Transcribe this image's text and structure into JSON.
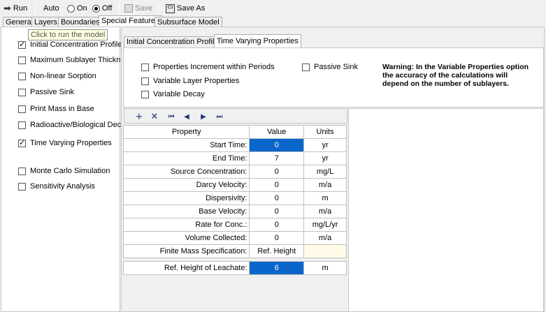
{
  "toolbar": {
    "run_label": "Run",
    "auto_label": "Auto",
    "on_label": "On",
    "off_label": "Off",
    "save_label": "Save",
    "save_as_label": "Save As"
  },
  "main_tabs": [
    "General",
    "Layers",
    "Boundaries",
    "Special Features",
    "Subsurface Model"
  ],
  "tooltip": "Click to run the model",
  "left_options": [
    {
      "label": "Initial Concentration Profile",
      "checked": true
    },
    {
      "label": "Maximum Sublayer Thickness",
      "checked": false
    },
    {
      "label": "Non-linear Sorption",
      "checked": false
    },
    {
      "label": "Passive Sink",
      "checked": false
    },
    {
      "label": "Print Mass in Base",
      "checked": false
    },
    {
      "label": "Radioactive/Biological Decay",
      "checked": false
    },
    {
      "label": "Time Varying Properties",
      "checked": true
    },
    {
      "label": "Monte Carlo Simulation",
      "checked": false
    },
    {
      "label": "Sensitivity Analysis",
      "checked": false
    }
  ],
  "sub_tabs": [
    "Initial Concentration Profile",
    "Time Varying Properties"
  ],
  "tvp_options": {
    "increment": "Properties Increment within Periods",
    "variable_layer": "Variable Layer Properties",
    "variable_decay": "Variable Decay",
    "passive_sink": "Passive Sink"
  },
  "warning": "Warning: In the Variable Properties option the accuracy of the calculations will depend on the number of sublayers.",
  "grid": {
    "headers": {
      "property": "Property",
      "value": "Value",
      "units": "Units"
    },
    "rows": [
      {
        "property": "Start Time:",
        "value": "0",
        "units": "yr"
      },
      {
        "property": "End Time:",
        "value": "7",
        "units": "yr"
      },
      {
        "property": "Source Concentration:",
        "value": "0",
        "units": "mg/L"
      },
      {
        "property": "Darcy Velocity:",
        "value": "0",
        "units": "m/a"
      },
      {
        "property": "Dispersivity:",
        "value": "0",
        "units": "m"
      },
      {
        "property": "Base Velocity:",
        "value": "0",
        "units": "m/a"
      },
      {
        "property": "Rate for Conc.:",
        "value": "0",
        "units": "mg/L/yr"
      },
      {
        "property": "Volume Collected:",
        "value": "0",
        "units": "m/a"
      },
      {
        "property": "Finite Mass Specification:",
        "value": "Ref. Height",
        "units": ""
      }
    ],
    "extra_row": {
      "property": "Ref. Height of Leachate:",
      "value": "6",
      "units": "m"
    }
  },
  "colors": {
    "selection": "#0b66cc",
    "cream": "#fffbe8"
  }
}
